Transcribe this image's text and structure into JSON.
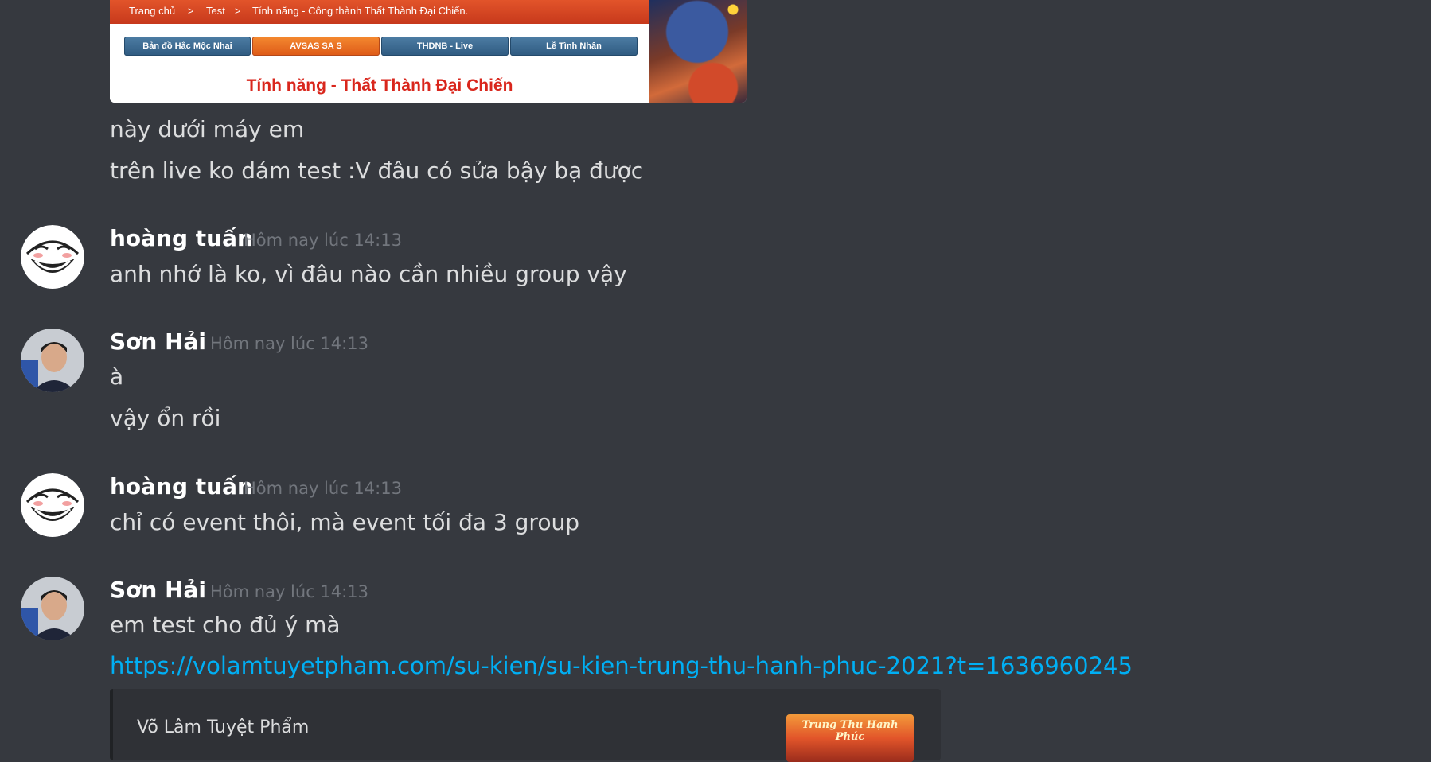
{
  "attachment": {
    "breadcrumb": [
      "Trang chủ",
      ">",
      "Test",
      ">",
      "Tính năng - Công thành Thất Thành Đại Chiến."
    ],
    "tabs": [
      "Bản đồ Hắc Mộc Nhai",
      "AVSAS SA S",
      "THDNB - Live",
      "Lễ Tình Nhân"
    ],
    "active_tab": 1,
    "title": "Tính năng - Thất Thành Đại Chiến"
  },
  "pre_messages": [
    "này dưới máy em",
    "trên live ko dám test :V đâu có sửa bậy bạ được"
  ],
  "groups": [
    {
      "author": "hoàng tuấn",
      "timestamp": "Hôm nay lúc 14:13",
      "avatar": "trollface-avatar",
      "messages": [
        "anh nhớ là ko, vì đâu nào cần nhiều group vậy"
      ]
    },
    {
      "author": "Sơn Hải",
      "timestamp": "Hôm nay lúc 14:13",
      "avatar": "photo-avatar",
      "messages": [
        "à",
        "vậy ổn rồi"
      ]
    },
    {
      "author": "hoàng tuấn",
      "timestamp": "Hôm nay lúc 14:13",
      "avatar": "trollface-avatar",
      "messages": [
        "chỉ có event thôi, mà event tối đa 3 group"
      ]
    },
    {
      "author": "Sơn Hải",
      "timestamp": "Hôm nay lúc 14:13",
      "avatar": "photo-avatar",
      "messages": [
        "em test cho đủ ý mà"
      ],
      "link": "https://volamtuyetpham.com/su-kien/su-kien-trung-thu-hanh-phuc-2021?t=1636960245",
      "embed": {
        "provider": "Võ Lâm Tuyệt Phẩm",
        "thumbnail_text": "Trung Thu Hạnh Phúc"
      }
    }
  ],
  "colors": {
    "background": "#36393f",
    "link": "#00aff4",
    "timestamp": "#72767d",
    "embed_bg": "#2f3136"
  }
}
